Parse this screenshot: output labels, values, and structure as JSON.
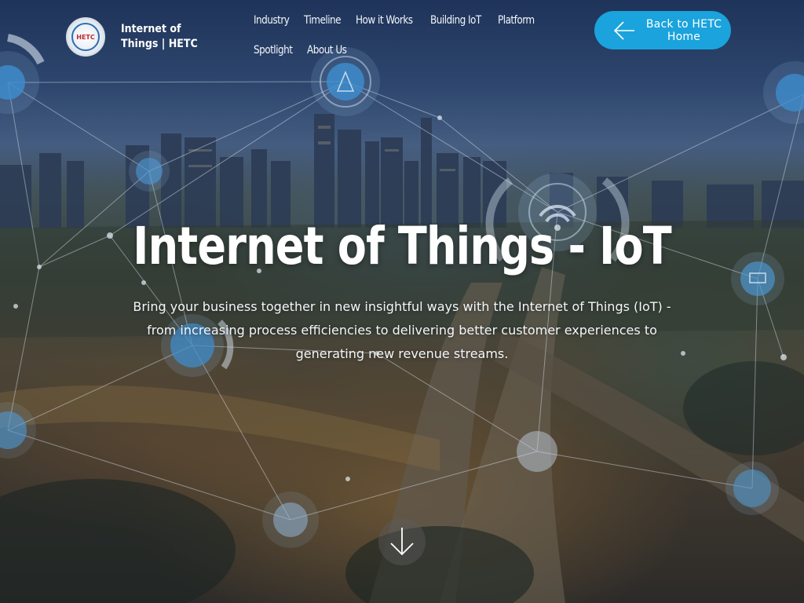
{
  "brand": {
    "logo_text": "HETC",
    "name": "Internet of Things | HETC"
  },
  "nav": {
    "items": [
      {
        "label": "Industry"
      },
      {
        "label": "Timeline"
      },
      {
        "label": "How it Works"
      },
      {
        "label": "Building IoT"
      },
      {
        "label": "Platform"
      },
      {
        "label": "Spotlight"
      },
      {
        "label": "About Us"
      }
    ]
  },
  "back_button": {
    "label": "Back to HETC Home",
    "icon": "arrow-left-icon"
  },
  "hero": {
    "title": "Internet of Things - IoT",
    "subtitle": "Bring your business together in new insightful ways with the Internet of Things (IoT) - from increasing process efficiencies to delivering better customer experiences to generating new revenue streams."
  },
  "scroll_button": {
    "icon": "arrow-down-icon"
  },
  "colors": {
    "accent": "#1aa3dc",
    "text": "#ffffff"
  }
}
